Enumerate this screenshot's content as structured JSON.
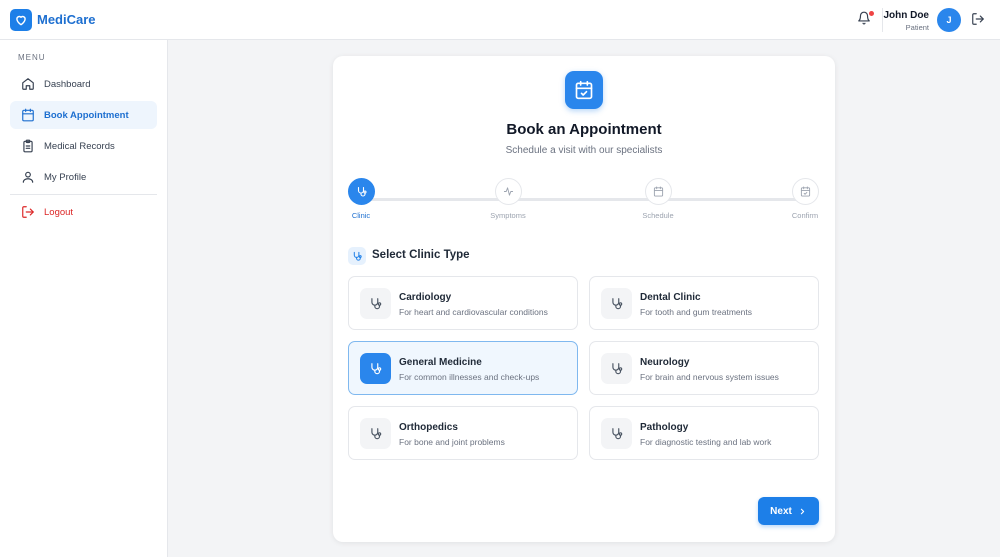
{
  "app": {
    "brand": "MediCare"
  },
  "header": {
    "user_name": "John Doe",
    "user_role": "Patient",
    "avatar_initial": "J",
    "notification_dot_color": "#ef4444"
  },
  "sidebar": {
    "menu_label": "MENU",
    "items": [
      {
        "label": "Dashboard",
        "icon": "home-icon"
      },
      {
        "label": "Book Appointment",
        "icon": "calendar-icon",
        "active": true
      },
      {
        "label": "Medical Records",
        "icon": "clipboard-icon"
      },
      {
        "label": "My Profile",
        "icon": "user-icon"
      }
    ],
    "logout_label": "Logout"
  },
  "booking": {
    "title": "Book an Appointment",
    "subtitle": "Schedule a visit with our specialists",
    "steps": [
      {
        "label": "Clinic",
        "icon": "stethoscope-icon",
        "active": true
      },
      {
        "label": "Symptoms",
        "icon": "activity-icon"
      },
      {
        "label": "Schedule",
        "icon": "calendar-icon"
      },
      {
        "label": "Confirm",
        "icon": "calendar-check-icon"
      }
    ],
    "section_title": "Select Clinic Type",
    "clinics": [
      {
        "name": "Cardiology",
        "desc": "For heart and cardiovascular conditions"
      },
      {
        "name": "Dental Clinic",
        "desc": "For tooth and gum treatments"
      },
      {
        "name": "General Medicine",
        "desc": "For common illnesses and check-ups",
        "selected": true
      },
      {
        "name": "Neurology",
        "desc": "For brain and nervous system issues"
      },
      {
        "name": "Orthopedics",
        "desc": "For bone and joint problems"
      },
      {
        "name": "Pathology",
        "desc": "For diagnostic testing and lab work"
      }
    ],
    "next_label": "Next"
  },
  "colors": {
    "accent": "#1d7fe8",
    "active_bg": "#eef5fd",
    "logout": "#dc2626"
  }
}
